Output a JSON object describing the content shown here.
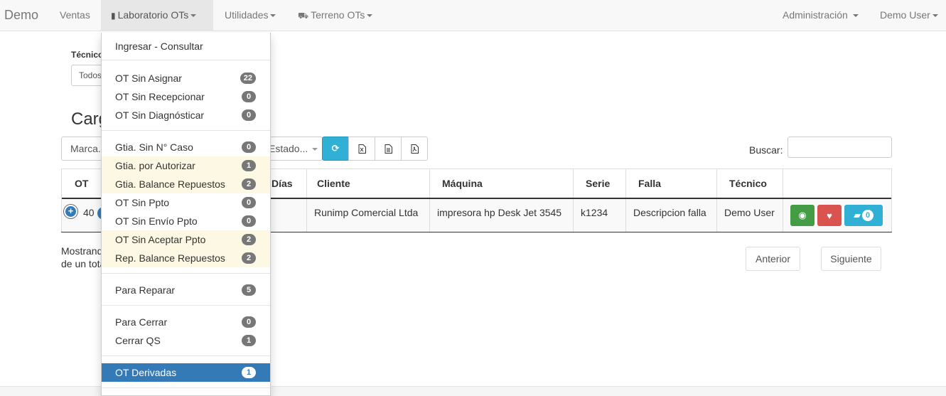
{
  "navbar": {
    "brand": "Demo",
    "items": [
      {
        "label": "Ventas"
      },
      {
        "label": "Laboratorio OTs"
      },
      {
        "label": "Utilidades"
      },
      {
        "label": "Terreno OTs"
      }
    ],
    "right": [
      {
        "label": "Administración"
      },
      {
        "label": "Demo User"
      }
    ]
  },
  "filters": {
    "tecnico_label": "Técnico",
    "tecnico_value": "Todos",
    "marca_placeholder": "Marca...",
    "estado_placeholder": "Estado...",
    "buscar_label": "Buscar:"
  },
  "heading": "Carg",
  "table": {
    "headers": [
      "OT",
      "Días",
      "Cliente",
      "Máquina",
      "Serie",
      "Falla",
      "Técnico"
    ],
    "row": {
      "ot": "40",
      "cliente": "Runimp Comercial Ltda",
      "maquina": "impresora hp Desk Jet 3545",
      "serie": "k1234",
      "falla": "Descripcion falla",
      "tecnico": "Demo User",
      "comments": "0"
    }
  },
  "info": {
    "line1": "Mostrando",
    "line2": "de un total"
  },
  "pager": {
    "prev": "Anterior",
    "next": "Siguiente"
  },
  "dropdown": {
    "items": [
      {
        "label": "Ingresar - Consultar",
        "badge": ""
      },
      {
        "label": "OT Sin Asignar",
        "badge": "22"
      },
      {
        "label": "OT Sin Recepcionar",
        "badge": "0"
      },
      {
        "label": "OT Sin Diagnósticar",
        "badge": "0"
      },
      {
        "label": "Gtia. Sin N° Caso",
        "badge": "0"
      },
      {
        "label": "Gtia. por Autorizar",
        "badge": "1"
      },
      {
        "label": "Gtia. Balance Repuestos",
        "badge": "2"
      },
      {
        "label": "OT Sin Ppto",
        "badge": "0"
      },
      {
        "label": "OT Sin Envío Ppto",
        "badge": "0"
      },
      {
        "label": "OT Sin Aceptar Ppto",
        "badge": "2"
      },
      {
        "label": "Rep. Balance Repuestos",
        "badge": "2"
      },
      {
        "label": "Para Reparar",
        "badge": "5"
      },
      {
        "label": "Para Cerrar",
        "badge": "0"
      },
      {
        "label": "Cerrar QS",
        "badge": "1"
      },
      {
        "label": "OT Derivadas",
        "badge": "1"
      }
    ]
  },
  "colors": {
    "primary": "#337ab7",
    "info": "#31b0d5",
    "success": "#449d44",
    "danger": "#d9534f",
    "warning_row": "#fcf8e3"
  }
}
